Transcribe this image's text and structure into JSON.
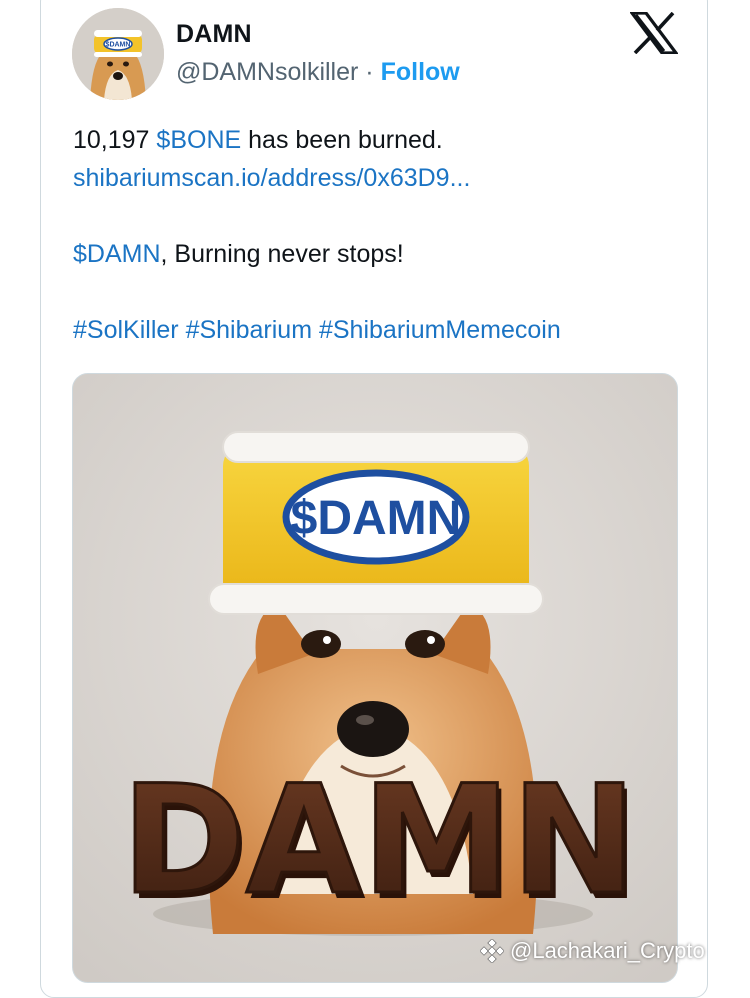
{
  "tweet": {
    "display_name": "DAMN",
    "handle": "@DAMNsolkiller",
    "separator": "·",
    "follow_label": "Follow",
    "avatar_label": "$DAMN",
    "line1_prefix": "10,197 ",
    "line1_cashtag": "$BONE",
    "line1_suffix": " has been burned.",
    "link_text": "shibariumscan.io/address/0x63D9...",
    "line3_cashtag": "$DAMN",
    "line3_suffix": ", Burning never stops!",
    "hashtags": [
      "#SolKiller",
      "#Shibarium",
      "#ShibariumMemecoin"
    ]
  },
  "media": {
    "hat_label": "$DAMN",
    "chocolate_text": "DAMN"
  },
  "watermark": {
    "text": "@Lachakari_Crypto"
  },
  "colors": {
    "link": "#1b74c4",
    "follow": "#1d9bf0",
    "secondary": "#536471",
    "border": "#cfd9de"
  }
}
